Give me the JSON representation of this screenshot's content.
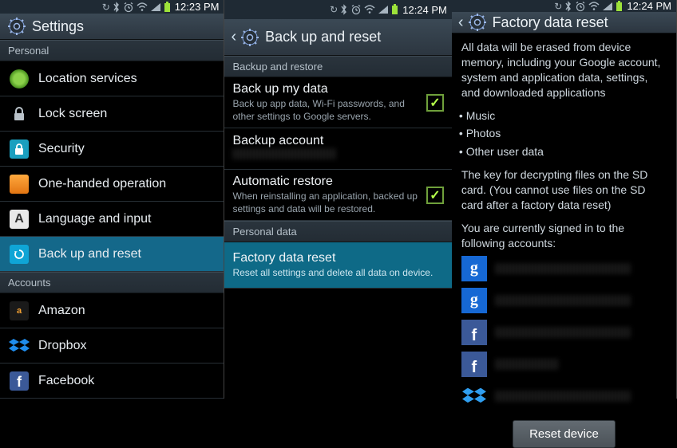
{
  "screen1": {
    "clock": "12:23 PM",
    "title": "Settings",
    "section_personal": "Personal",
    "items_personal": [
      {
        "label": "Location services"
      },
      {
        "label": "Lock screen"
      },
      {
        "label": "Security"
      },
      {
        "label": "One-handed operation"
      },
      {
        "label": "Language and input"
      },
      {
        "label": "Back up and reset"
      }
    ],
    "section_accounts": "Accounts",
    "items_accounts": [
      {
        "label": "Amazon"
      },
      {
        "label": "Dropbox"
      },
      {
        "label": "Facebook"
      }
    ]
  },
  "screen2": {
    "clock": "12:24 PM",
    "title": "Back up and reset",
    "section_backup": "Backup and restore",
    "backup_data": {
      "title": "Back up my data",
      "sub": "Back up app data, Wi-Fi passwords, and other settings to Google servers."
    },
    "backup_account": {
      "title": "Backup account"
    },
    "auto_restore": {
      "title": "Automatic restore",
      "sub": "When reinstalling an application, backed up settings and data will be restored."
    },
    "section_personal_data": "Personal data",
    "factory_reset": {
      "title": "Factory data reset",
      "sub": "Reset all settings and delete all data on device."
    }
  },
  "screen3": {
    "clock": "12:24 PM",
    "title": "Factory data reset",
    "para1": "All data will be erased from device memory, including your Google account, system and application data, settings, and downloaded applications",
    "bullets": [
      "Music",
      "Photos",
      "Other user data"
    ],
    "para2": "The key for decrypting files on the SD card. (You cannot use files on the SD card after a factory data reset)",
    "para3": "You are currently signed in to the following accounts:",
    "reset_btn": "Reset device"
  }
}
